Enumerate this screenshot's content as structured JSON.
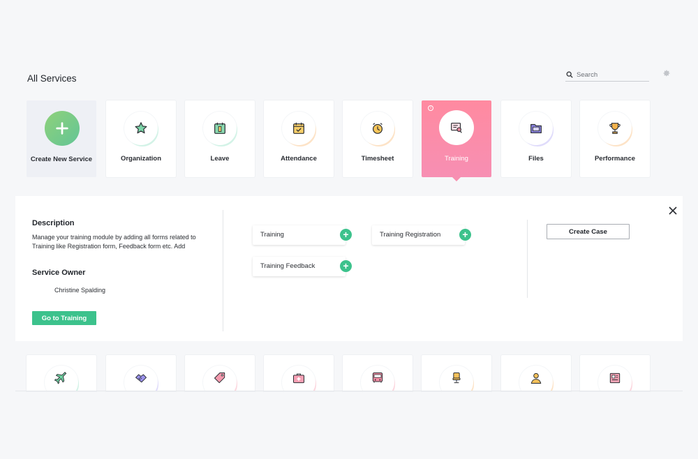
{
  "header": {
    "title": "All Services",
    "search_placeholder": "Search",
    "search_icon": "search-icon",
    "settings_icon": "gear-icon"
  },
  "services": [
    {
      "label": "Create New Service",
      "icon": "plus-icon"
    },
    {
      "label": "Organization",
      "icon": "star-icon"
    },
    {
      "label": "Leave",
      "icon": "leave-icon"
    },
    {
      "label": "Attendance",
      "icon": "calendar-check-icon"
    },
    {
      "label": "Timesheet",
      "icon": "alarm-clock-icon"
    },
    {
      "label": "Training",
      "icon": "training-icon",
      "selected": true
    },
    {
      "label": "Files",
      "icon": "folder-icon"
    },
    {
      "label": "Performance",
      "icon": "trophy-icon"
    }
  ],
  "detail": {
    "description_heading": "Description",
    "description_text": "Manage your training module by adding all forms related to Training like Registration form, Feedback form etc. Add",
    "owner_heading": "Service Owner",
    "owner_name": "Christine Spalding",
    "goto_button": "Go to Training",
    "forms": [
      {
        "label": "Training"
      },
      {
        "label": "Training Registration"
      },
      {
        "label": "Training Feedback"
      }
    ],
    "add_symbol": "+",
    "create_case_button": "Create Case",
    "close_icon": "close-icon"
  },
  "more_services_icons": [
    "airplane-icon",
    "handshake-icon",
    "tag-icon",
    "medical-kit-icon",
    "bus-icon",
    "office-chair-icon",
    "employee-icon",
    "newspaper-icon"
  ],
  "colors": {
    "accent_green": "#3cc28c",
    "selected_pink": "#f78fb3",
    "background": "#f6f7f9"
  }
}
